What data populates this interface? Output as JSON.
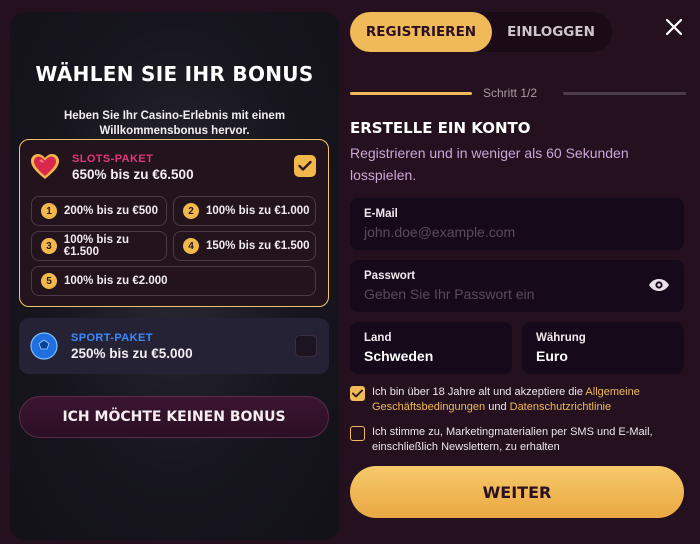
{
  "left": {
    "title": "WÄHLEN SIE IHR BONUS",
    "subtitle": "Heben Sie Ihr Casino-Erlebnis mit einem Willkommensbonus hervor.",
    "slots": {
      "name": "SLOTS-PAKET",
      "amount": "650% bis zu €6.500",
      "selected": true,
      "options": [
        {
          "num": "1",
          "label": "200% bis zu €500"
        },
        {
          "num": "2",
          "label": "100% bis zu €1.000"
        },
        {
          "num": "3",
          "label": "100% bis zu €1.500"
        },
        {
          "num": "4",
          "label": "150% bis zu €1.500"
        },
        {
          "num": "5",
          "label": "100% bis zu €2.000"
        }
      ]
    },
    "sport": {
      "name": "SPORT-PAKET",
      "amount": "250% bis zu €5.000",
      "selected": false
    },
    "no_bonus_label": "ICH MÖCHTE KEINEN BONUS"
  },
  "tabs": {
    "register": "REGISTRIEREN",
    "login": "EINLOGGEN"
  },
  "step": "Schritt 1/2",
  "form": {
    "title": "ERSTELLE EIN KONTO",
    "subtitle": "Registrieren und in weniger als 60 Sekunden losspielen.",
    "email_label": "E-Mail",
    "email_placeholder": "john.doe@example.com",
    "password_label": "Passwort",
    "password_placeholder": "Geben Sie Ihr Passwort ein",
    "country_label": "Land",
    "country_value": "Schweden",
    "currency_label": "Währung",
    "currency_value": "Euro",
    "terms": {
      "checked": true,
      "prefix": "Ich bin über 18 Jahre alt und akzeptiere die ",
      "link1": "Allgemeine Geschäftsbedingungen",
      "middle": " und ",
      "link2": "Datenschutzrichtlinie"
    },
    "marketing": {
      "checked": false,
      "text": "Ich stimme zu, Marketingmaterialien per SMS und E-Mail, einschließlich Newslettern, zu erhalten"
    },
    "submit_label": "WEITER"
  },
  "colors": {
    "accent": "#f1ba58",
    "slots_name": "#e0377c",
    "sport_name": "#3b8bff",
    "subtitle": "#c9a7d8",
    "background": "#24101f"
  },
  "icons": {
    "slots": "heart-gem-icon",
    "sport": "soccer-ball-icon",
    "close": "close-icon",
    "password_toggle": "eye-icon",
    "check": "check-icon"
  }
}
